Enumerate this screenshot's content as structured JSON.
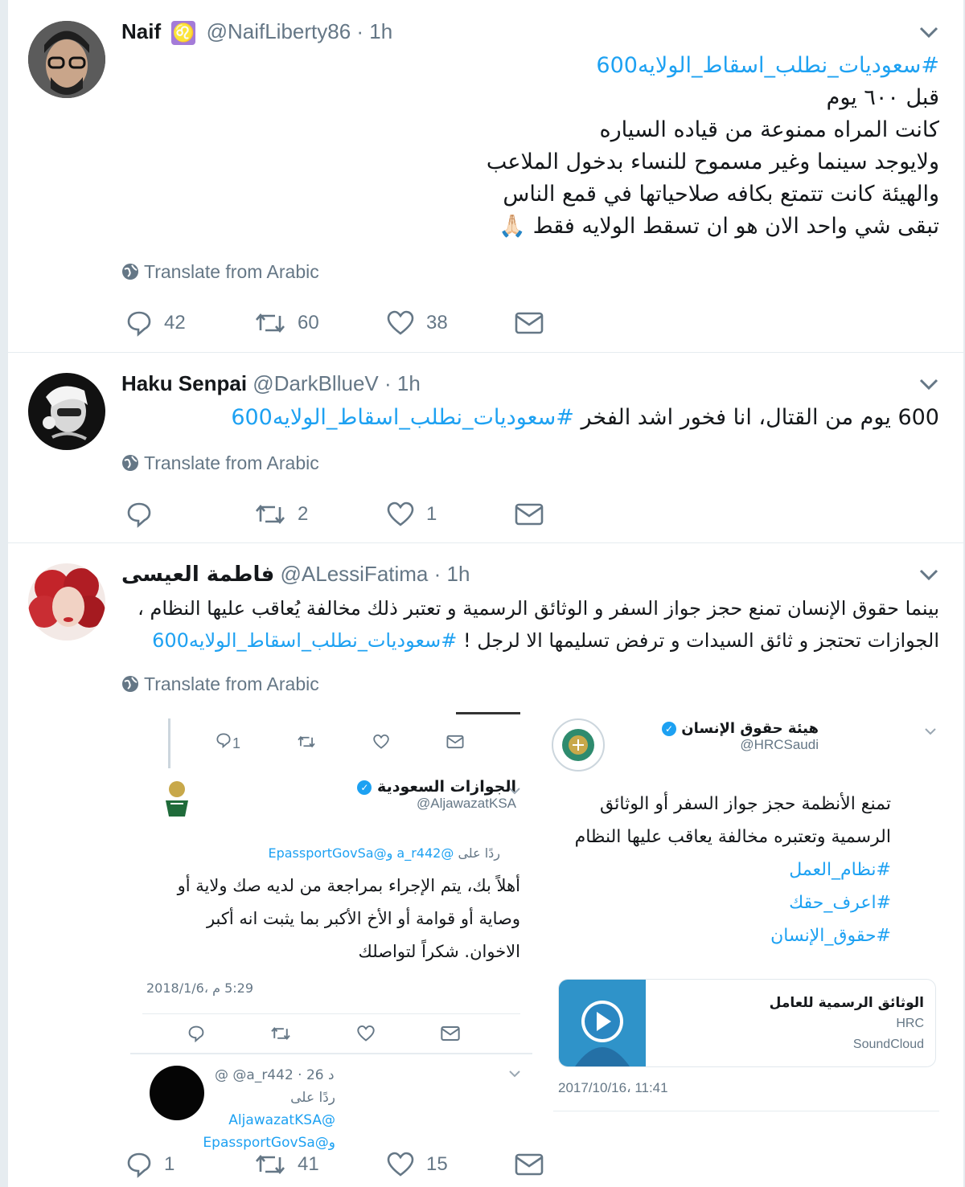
{
  "tweets": [
    {
      "name": "Naif",
      "badge": "♌",
      "handle": "@NaifLiberty86",
      "time": "· 1h",
      "hashtag": "#سعوديات_نطلب_اسقاط_الولايه600",
      "lines": [
        "قبل ٦٠٠ يوم",
        "كانت المراه ممنوعة من قياده السياره",
        "ولايوجد سينما وغير مسموح للنساء بدخول الملاعب",
        "والهيئة كانت تتمتع بكافه صلاحياتها في قمع الناس",
        "تبقى شي واحد الان هو  ان تسقط الولايه فقط 🙏🏻"
      ],
      "translate": "Translate from Arabic",
      "replies": "42",
      "retweets": "60",
      "likes": "38"
    },
    {
      "name": "Haku Senpai",
      "handle": "@DarkBllueV",
      "time": "· 1h",
      "text": "600 يوم من القتال، انا فخور اشد الفخر ",
      "hashtag": "#سعوديات_نطلب_اسقاط_الولايه600",
      "translate": "Translate from Arabic",
      "replies": "",
      "retweets": "2",
      "likes": "1"
    },
    {
      "name": "فاطمة العيسى",
      "handle": "@ALessiFatima",
      "time": "· 1h",
      "line1": "بينما حقوق الإنسان تمنع حجز جواز السفر و الوثائق الرسمية و تعتبر ذلك مخالفة يُعاقب عليها النظام ،",
      "line2": "الجوازات تحتجز و ثائق السيدات و ترفض تسليمها الا لرجل ! ",
      "hashtag": "#سعوديات_نطلب_اسقاط_الولايه600",
      "translate": "Translate from Arabic",
      "replies": "1",
      "retweets": "41",
      "likes": "15"
    }
  ],
  "quote_left": {
    "top_reply_count": "1",
    "account_name": "الجوازات السعودية",
    "account_handle": "@AljawazatKSA",
    "reply_to_label": "ردًا على",
    "reply_to": "@a_r442 و@EpassportGovSa",
    "lines": [
      "أهلاً بك، يتم الإجراء بمراجعة من لديه صك ولاية أو",
      "وصاية أو قوامة أو الأخ الأكبر بما يثبت انه أكبر",
      "الاخوان. شكراً لتواصلك"
    ],
    "timestamp": "5:29 م ،2018/1/6",
    "sub_handle": "@ @a_r442 · 26 د",
    "sub_reply_label": "ردًا على",
    "sub_reply_to_1": "@AljawazatKSA",
    "sub_reply_to_2": "و@EpassportGovSa"
  },
  "quote_right": {
    "account_name": "هيئة حقوق الإنسان",
    "account_handle": "@HRCSaudi",
    "lines": [
      "تمنع الأنظمة حجز جواز السفر أو الوثائق",
      "الرسمية وتعتبره مخالفة يعاقب عليها النظام"
    ],
    "hashtags": [
      "#نظام_العمل",
      "#اعرف_حقك",
      "#حقوق_الإنسان"
    ],
    "card_title": "الوثائق الرسمية للعامل",
    "card_author": "HRC",
    "card_source": "SoundCloud",
    "timestamp": "11:41 ،2017/10/16"
  },
  "colors": {
    "link": "#1da1f2",
    "muted": "#657786",
    "badge": "#a47bd8",
    "divider": "#e6ecf0"
  }
}
